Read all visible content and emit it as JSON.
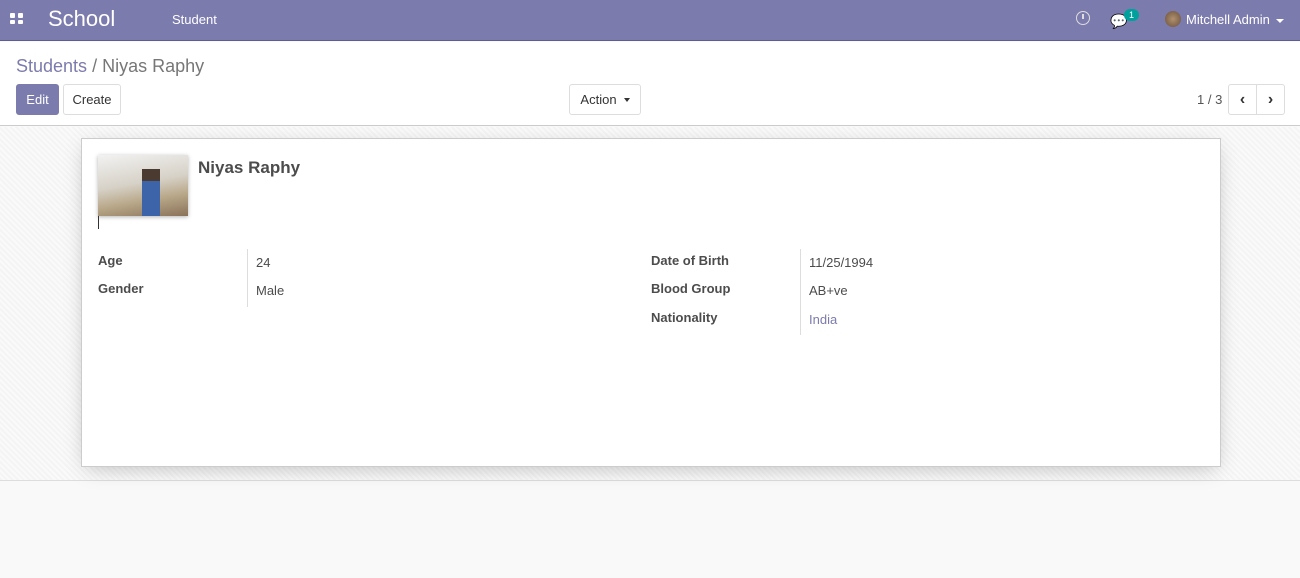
{
  "navbar": {
    "app_name": "School",
    "menu": "Student",
    "messages_count": "1",
    "user": "Mitchell Admin"
  },
  "breadcrumb": {
    "parent": "Students",
    "separator": " / ",
    "current": "Niyas Raphy"
  },
  "toolbar": {
    "edit": "Edit",
    "create": "Create",
    "action": "Action"
  },
  "pager": {
    "text": "1 / 3"
  },
  "colors": {
    "brand": "#7c7bad",
    "badge": "#00a09d"
  },
  "record": {
    "name": "Niyas Raphy",
    "left": [
      {
        "label": "Age",
        "value": "24"
      },
      {
        "label": "Gender",
        "value": "Male"
      }
    ],
    "right": [
      {
        "label": "Date of Birth",
        "value": "11/25/1994"
      },
      {
        "label": "Blood Group",
        "value": "AB+ve"
      },
      {
        "label": "Nationality",
        "value": "India"
      }
    ]
  }
}
